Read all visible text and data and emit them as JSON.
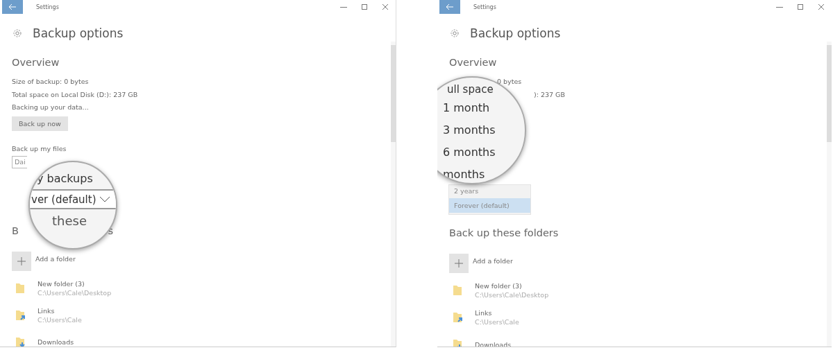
{
  "windows": [
    {
      "title": "Settings",
      "heading": "Backup options",
      "overview_heading": "Overview",
      "overview_lines": [
        "Size of backup: 0 bytes",
        "Total space on Local Disk (D:): 237 GB",
        "Backing up your data..."
      ],
      "backup_button": "Back up now",
      "files_label": "Back up my files",
      "frequency_dropdown": {
        "value": "Dai"
      },
      "folders_heading_parts": [
        "B",
        "s"
      ],
      "add_folder": "Add a folder",
      "folders": [
        {
          "name": "New folder (3)",
          "path": "C:\\Users\\Cale\\Desktop",
          "kind": "folder"
        },
        {
          "name": "Links",
          "path": "C:\\Users\\Cale",
          "kind": "link"
        },
        {
          "name": "Downloads",
          "kind": "download"
        }
      ],
      "magnifier": {
        "kind": "field",
        "items": [
          {
            "kind": "label",
            "text": "y backups"
          },
          {
            "kind": "field",
            "text": "ver (default)"
          },
          {
            "kind": "heading",
            "text": "these"
          }
        ]
      }
    },
    {
      "title": "Settings",
      "heading": "Backup options",
      "overview_heading": "Overview",
      "overview_lines": [
        "0 bytes",
        "): 237 GB"
      ],
      "folders_heading_parts": [
        "Back up these folders"
      ],
      "add_folder": "Add a folder",
      "folders": [
        {
          "name": "New folder (3)",
          "path": "C:\\Users\\Cale\\Desktop",
          "kind": "folder"
        },
        {
          "name": "Links",
          "path": "C:\\Users\\Cale",
          "kind": "link"
        },
        {
          "name": "Downloads",
          "kind": "download"
        }
      ],
      "retention_list": [
        {
          "label": "2 years",
          "selected": false
        },
        {
          "label": "Forever (default)",
          "selected": true
        }
      ],
      "magnifier": {
        "kind": "list",
        "items": [
          {
            "kind": "label",
            "text": "ull space"
          },
          {
            "kind": "option",
            "text": "1 month"
          },
          {
            "kind": "option",
            "text": "3 months"
          },
          {
            "kind": "option",
            "text": "6 months"
          },
          {
            "kind": "option",
            "text": "months"
          }
        ]
      }
    }
  ]
}
